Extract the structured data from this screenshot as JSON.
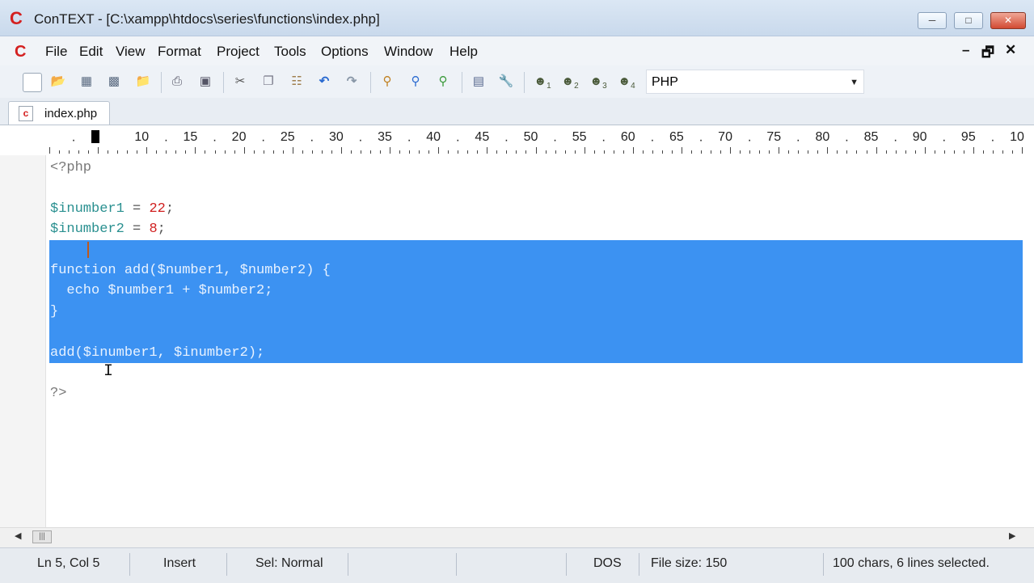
{
  "window": {
    "title": "ConTEXT - [C:\\xampp\\htdocs\\series\\functions\\index.php]",
    "logo": "C",
    "controls": [
      "minimize",
      "maximize",
      "close"
    ]
  },
  "menu": {
    "logo": "C",
    "items": [
      "File",
      "Edit",
      "View",
      "Format",
      "Project",
      "Tools",
      "Options",
      "Window",
      "Help"
    ],
    "mdi_controls": [
      "–",
      "🗗",
      "✕"
    ]
  },
  "toolbar": {
    "icons": [
      "new-file-icon",
      "open-file-icon",
      "save-icon",
      "save-all-icon",
      "open-folder-icon",
      "print-icon",
      "print-preview-icon",
      "cut-icon",
      "copy-icon",
      "paste-icon",
      "undo-icon",
      "redo-icon",
      "find-icon",
      "find-next-icon",
      "replace-icon",
      "document-icon",
      "tools-icon",
      "user-command-1-icon",
      "user-command-2-icon",
      "user-command-3-icon",
      "user-command-4-icon"
    ],
    "user_command_subscripts": [
      "1",
      "2",
      "3",
      "4"
    ],
    "syntax_value": "PHP"
  },
  "tabs": [
    {
      "label": "index.php",
      "active": true
    }
  ],
  "ruler": {
    "labels": [
      "10",
      "15",
      "20",
      "25",
      "30",
      "35",
      "40",
      "45",
      "50",
      "55",
      "60",
      "65",
      "70",
      "75",
      "80",
      "85",
      "90",
      "95",
      "10"
    ]
  },
  "code": {
    "lines": [
      {
        "tokens": [
          {
            "t": "<?php",
            "c": "tag"
          }
        ]
      },
      {
        "tokens": []
      },
      {
        "tokens": [
          {
            "t": "$inumber1",
            "c": "var"
          },
          {
            "t": " = ",
            "c": "op"
          },
          {
            "t": "22",
            "c": "num"
          },
          {
            "t": ";",
            "c": "op"
          }
        ]
      },
      {
        "tokens": [
          {
            "t": "$inumber2",
            "c": "var"
          },
          {
            "t": " = ",
            "c": "op"
          },
          {
            "t": "8",
            "c": "num"
          },
          {
            "t": ";",
            "c": "op"
          }
        ]
      },
      {
        "tokens": [],
        "selected": true
      },
      {
        "tokens": [
          {
            "t": "function add($number1, $number2) {",
            "c": "sel"
          }
        ],
        "selected": true
      },
      {
        "tokens": [
          {
            "t": "  echo $number1 + $number2;",
            "c": "sel"
          }
        ],
        "selected": true
      },
      {
        "tokens": [
          {
            "t": "}",
            "c": "sel"
          }
        ],
        "selected": true
      },
      {
        "tokens": [],
        "selected": true
      },
      {
        "tokens": [
          {
            "t": "add($inumber1, $inumber2);",
            "c": "sel"
          }
        ],
        "selected": true
      },
      {
        "tokens": []
      },
      {
        "tokens": [
          {
            "t": "?>",
            "c": "tag"
          }
        ]
      }
    ]
  },
  "status": {
    "position": "Ln 5, Col 5",
    "mode": "Insert",
    "selection_mode": "Sel: Normal",
    "line_endings": "DOS",
    "file_size": "File size: 150",
    "selection_info": "100 chars, 6 lines selected."
  }
}
